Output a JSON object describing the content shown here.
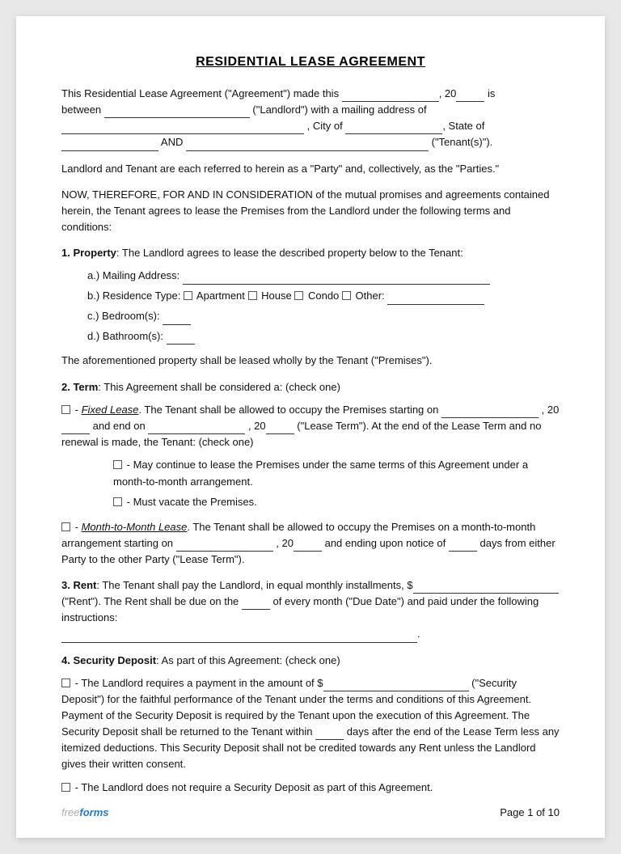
{
  "title": "RESIDENTIAL LEASE AGREEMENT",
  "intro": {
    "line1": "This Residential Lease Agreement (\"Agreement\") made this",
    "line1_mid": ", 20",
    "line1_end": "is",
    "line2_start": "between",
    "line2_mid": "(\"Landlord\") with a mailing address of",
    "line3_mid": ", City of",
    "line3_end": ", State of",
    "line4_start": "",
    "line4_and": "AND",
    "line4_end": "(\"Tenant(s)\")."
  },
  "party_ref": "Landlord and Tenant are each referred to herein as a \"Party\" and, collectively, as the \"Parties.\"",
  "consideration": "NOW, THEREFORE, FOR AND IN CONSIDERATION of the mutual promises and agreements contained herein, the Tenant agrees to lease the Premises from the Landlord under the following terms and conditions:",
  "section1": {
    "heading": "1. Property",
    "text": ": The Landlord agrees to lease the described property below to the Tenant:",
    "items": {
      "a_label": "a.)  Mailing Address:",
      "b_label": "b.)  Residence Type:",
      "b_options": [
        "Apartment",
        "House",
        "Condo",
        "Other:"
      ],
      "c_label": "c.)  Bedroom(s):",
      "d_label": "d.)  Bathroom(s):"
    },
    "footer_text": "The aforementioned property shall be leased wholly by the Tenant (\"Premises\")."
  },
  "section2": {
    "heading": "2. Term",
    "text": ": This Agreement shall be considered a: (check one)",
    "fixed_lease": {
      "label": "Fixed Lease",
      "text1": ". The Tenant shall be allowed to occupy the Premises starting on",
      "text2": ", 20",
      "text3": "and end on",
      "text4": ", 20",
      "text5": "(\"Lease Term\"). At the end of the Lease Term and no renewal is made, the Tenant: (check one)",
      "option1": "- May continue to lease the Premises under the same terms of this Agreement under a month-to-month arrangement.",
      "option2": "- Must vacate the Premises."
    },
    "month_lease": {
      "label": "Month-to-Month Lease",
      "text1": ". The Tenant shall be allowed to occupy the Premises on a month-to-month arrangement starting on",
      "text2": ", 20",
      "text3": "and ending upon notice of",
      "text4": "days from either Party to the other Party (\"Lease Term\")."
    }
  },
  "section3": {
    "heading": "3. Rent",
    "text1": ": The Tenant shall pay the Landlord, in equal monthly installments, $",
    "text2": "(\"Rent\"). The Rent shall be due on the",
    "text3": "of every month (\"Due Date\") and paid under the following instructions:"
  },
  "section4": {
    "heading": "4. Security Deposit",
    "text": ": As part of this Agreement: (check one)",
    "option1_text1": "- The Landlord requires a payment in the amount of $",
    "option1_text2": "(\"Security Deposit\") for the faithful performance of the Tenant under the terms and conditions of this Agreement. Payment of the Security Deposit is required by the Tenant upon the execution of this Agreement. The Security Deposit shall be returned to the Tenant within",
    "option1_text3": "days after the end of the Lease Term less any itemized deductions. This Security Deposit shall not be credited towards any Rent unless the Landlord gives their written consent.",
    "option2_text": "- The Landlord does not require a Security Deposit as part of this Agreement."
  },
  "footer": {
    "brand_prefix": "free",
    "brand_suffix": "forms",
    "page_text": "Page 1 of 10"
  }
}
